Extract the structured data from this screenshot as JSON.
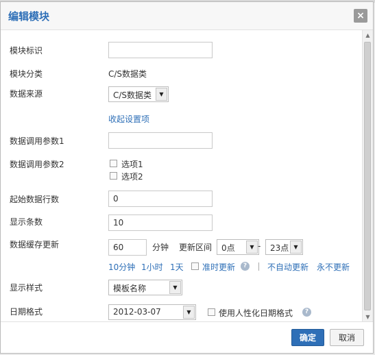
{
  "dialog": {
    "title": "编辑模块",
    "close_symbol": "×",
    "icons": {
      "close": "close-icon",
      "help": "question-icon",
      "dropdown": "chevron-down-icon"
    }
  },
  "form": {
    "module_id": {
      "label": "模块标识",
      "value": ""
    },
    "module_category": {
      "label": "模块分类",
      "value": "C/S数据类"
    },
    "data_source": {
      "label": "数据来源",
      "selected": "C/S数据类"
    },
    "collapse_link": "收起设置项",
    "param1": {
      "label": "数据调用参数1",
      "value": ""
    },
    "param2": {
      "label": "数据调用参数2",
      "options": [
        "选项1",
        "选项2"
      ]
    },
    "start_row": {
      "label": "起始数据行数",
      "value": "0"
    },
    "display_count": {
      "label": "显示条数",
      "value": "10"
    },
    "cache": {
      "label": "数据缓存更新",
      "minutes": "60",
      "minutes_unit": "分钟",
      "range_label": "更新区间",
      "range_start": "0点",
      "range_dash": "-",
      "range_end": "23点",
      "quick_links": [
        "10分钟",
        "1小时",
        "1天"
      ],
      "scheduled_update": "准时更新",
      "no_auto_update": "不自动更新",
      "never_update": "永不更新"
    },
    "display_style": {
      "label": "显示样式",
      "selected": "模板名称"
    },
    "date_format": {
      "label": "日期格式",
      "selected": "2012-03-07",
      "humanized_label": "使用人性化日期格式"
    }
  },
  "footer": {
    "ok_label": "确定",
    "cancel_label": "取消"
  }
}
